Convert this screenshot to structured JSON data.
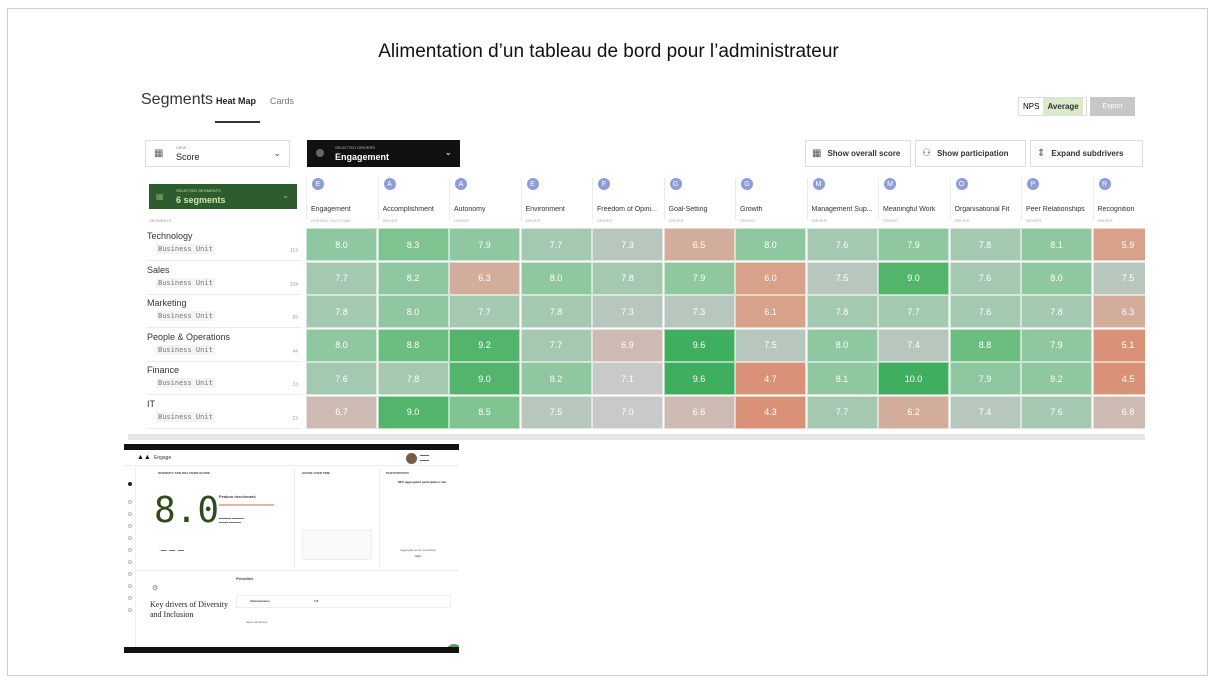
{
  "slide": {
    "title": "Alimentation d’un tableau de bord pour l’administrateur"
  },
  "heatmap": {
    "title": "Segments",
    "tabs": [
      "Heat Map",
      "Cards"
    ],
    "active_tab": "Heat Map",
    "toggle": [
      "NPS",
      "Average"
    ],
    "toggle_active": "Average",
    "export_label": "Export",
    "view": {
      "label": "VIEW",
      "value": "Score",
      "icon": "grid-icon"
    },
    "drivers": {
      "label": "SELECTED DRIVERS",
      "value": "Engagement"
    },
    "buttons": [
      {
        "label": "Show overall score",
        "icon": "calendar-icon"
      },
      {
        "label": "Show participation",
        "icon": "people-icon"
      },
      {
        "label": "Expand subdrivers",
        "icon": "expand-icon"
      }
    ],
    "segments_selector": {
      "label": "SELECTED SEGMENTS",
      "value": "6 segments"
    },
    "segments_col_label": "SEGMENTS",
    "columns": [
      {
        "name": "Engagement",
        "type": "OVERALL OUTCOME",
        "icon": "E"
      },
      {
        "name": "Accomplishment",
        "type": "DRIVER",
        "icon": "A"
      },
      {
        "name": "Autonomy",
        "type": "DRIVER",
        "icon": "A"
      },
      {
        "name": "Environment",
        "type": "DRIVER",
        "icon": "E"
      },
      {
        "name": "Freedom of Opini...",
        "type": "DRIVER",
        "icon": "F"
      },
      {
        "name": "Goal-Setting",
        "type": "DRIVER",
        "icon": "G"
      },
      {
        "name": "Growth",
        "type": "DRIVER",
        "icon": "G"
      },
      {
        "name": "Management Sup...",
        "type": "DRIVER",
        "icon": "M"
      },
      {
        "name": "Meaningful Work",
        "type": "DRIVER",
        "icon": "M"
      },
      {
        "name": "Organisational Fit",
        "type": "DRIVER",
        "icon": "O"
      },
      {
        "name": "Peer Relationships",
        "type": "DRIVER",
        "icon": "P"
      },
      {
        "name": "Recognition",
        "type": "DRIVER",
        "icon": "R"
      }
    ],
    "rows": [
      {
        "name": "Technology",
        "unit": "Business Unit",
        "count": "113",
        "values": [
          "8.0",
          "8.3",
          "7.9",
          "7.7",
          "7.3",
          "6.5",
          "8.0",
          "7.6",
          "7.9",
          "7.8",
          "8.1",
          "5.9"
        ]
      },
      {
        "name": "Sales",
        "unit": "Business Unit",
        "count": "104",
        "values": [
          "7.7",
          "8.2",
          "6.3",
          "8.0",
          "7.8",
          "7.9",
          "6.0",
          "7.5",
          "9.0",
          "7.6",
          "8.0",
          "7.5"
        ]
      },
      {
        "name": "Marketing",
        "unit": "Business Unit",
        "count": "89",
        "values": [
          "7.8",
          "8.0",
          "7.7",
          "7.8",
          "7.3",
          "7.3",
          "6.1",
          "7.8",
          "7.7",
          "7.6",
          "7.8",
          "6.3"
        ]
      },
      {
        "name": "People & Operations",
        "unit": "Business Unit",
        "count": "44",
        "values": [
          "8.0",
          "8.8",
          "9.2",
          "7.7",
          "6.9",
          "9.6",
          "7.5",
          "8.0",
          "7.4",
          "8.8",
          "7.9",
          "5.1"
        ]
      },
      {
        "name": "Finance",
        "unit": "Business Unit",
        "count": "33",
        "values": [
          "7.6",
          "7.8",
          "9.0",
          "8.2",
          "7.1",
          "9.6",
          "4.7",
          "8.1",
          "10.0",
          "7.9",
          "8.2",
          "4.5"
        ]
      },
      {
        "name": "IT",
        "unit": "Business Unit",
        "count": "23",
        "values": [
          "6.7",
          "9.0",
          "8.5",
          "7.5",
          "7.0",
          "6.6",
          "4.3",
          "7.7",
          "6.2",
          "7.4",
          "7.6",
          "6.8"
        ]
      }
    ],
    "colors": {
      "high": "#3fae5e",
      "mid_high": "#86c79a",
      "neutral": "#c9c9c9",
      "low": "#d99a85"
    }
  },
  "dashboard_thumbnail": {
    "app_name": "Engage",
    "score_card_title": "DIVERSITY AND INCLUSION SCORE",
    "score": "8.0",
    "benchmark_title": "Peakon benchmark",
    "over_time_title": "SCORE OVER TIME",
    "participation_title": "PARTICIPATION",
    "participation_value": "88% aggregated participation rate",
    "priorities_title": "Priorities",
    "key_drivers_title": "Key drivers of Diversity and Inclusion",
    "show_all": "Show all drivers",
    "inclusiveness": "Inclusiveness",
    "inclusiveness_score": "7.8",
    "aggregate_label": "Aggregate score sensitivity",
    "aggregate_value": "High"
  }
}
